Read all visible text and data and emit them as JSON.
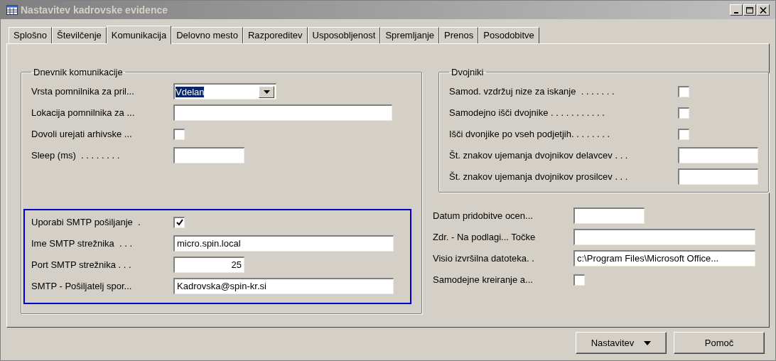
{
  "window": {
    "title": "Nastavitev kadrovske evidence"
  },
  "tabs": [
    {
      "label": "Splošno",
      "selected": false
    },
    {
      "label": "Številčenje",
      "selected": false
    },
    {
      "label": "Komunikacija",
      "selected": true
    },
    {
      "label": "Delovno mesto",
      "selected": false
    },
    {
      "label": "Razporeditev",
      "selected": false
    },
    {
      "label": "Usposobljenost",
      "selected": false
    },
    {
      "label": "Spremljanje",
      "selected": false
    },
    {
      "label": "Prenos",
      "selected": false
    },
    {
      "label": "Posodobitve",
      "selected": false
    }
  ],
  "log_group": {
    "title": "Dnevnik komunikacije",
    "fields": [
      {
        "label": "Vrsta pomnilnika za pril...",
        "kind": "dropdown",
        "value": "Vdelan",
        "value_highlighted": true
      },
      {
        "label": "Lokacija pomnilnika za ...",
        "kind": "text"
      },
      {
        "label": "Dovoli urejati arhivske ...",
        "kind": "checkbox",
        "checked": false
      },
      {
        "label": "Sleep (ms)  . . . . . . . .",
        "kind": "short-text"
      }
    ],
    "highlighted_fields": [
      {
        "label": "Uporabi SMTP pošiljanje  .",
        "kind": "checkbox",
        "checked": true
      },
      {
        "label": "Ime SMTP strežnika  . . .",
        "kind": "text",
        "value": "micro.spin.local"
      },
      {
        "label": "Port SMTP strežnika . . .",
        "kind": "number",
        "value": "25"
      },
      {
        "label": "SMTP - Pošiljatelj spor...",
        "kind": "text",
        "value": "Kadrovska@spin-kr.si"
      }
    ]
  },
  "duplicates_group": {
    "title": "Dvojniki",
    "fields": [
      {
        "label": "Samod. vzdržuj nize za iskanje  . . . . . . .",
        "kind": "checkbox",
        "checked": false
      },
      {
        "label": "Samodejno išči dvojnike . . . . . . . . . . .",
        "kind": "checkbox",
        "checked": false
      },
      {
        "label": "Išči dvonjike po vseh podjetjih. . . . . . . .",
        "kind": "checkbox",
        "checked": false
      },
      {
        "label": "Št. znakov ujemanja dvojnikov delavcev . . .",
        "kind": "text"
      },
      {
        "label": "Št. znakov ujemanja dvojnikov prosilcev . . .",
        "kind": "text"
      }
    ]
  },
  "other_fields": [
    {
      "label": "Datum pridobitve ocen...",
      "kind": "short-text"
    },
    {
      "label": "Zdr. - Na podlagi... Točke",
      "kind": "text"
    },
    {
      "label": "Visio izvršilna datoteka. .",
      "kind": "text",
      "value": "c:\\Program Files\\Microsoft Office..."
    },
    {
      "label": "Samodejne kreiranje a...",
      "kind": "checkbox",
      "checked": false
    }
  ],
  "buttons": [
    {
      "label": "Nastavitev",
      "kind": "menu"
    },
    {
      "label": "Pomoč",
      "kind": "plain"
    }
  ]
}
